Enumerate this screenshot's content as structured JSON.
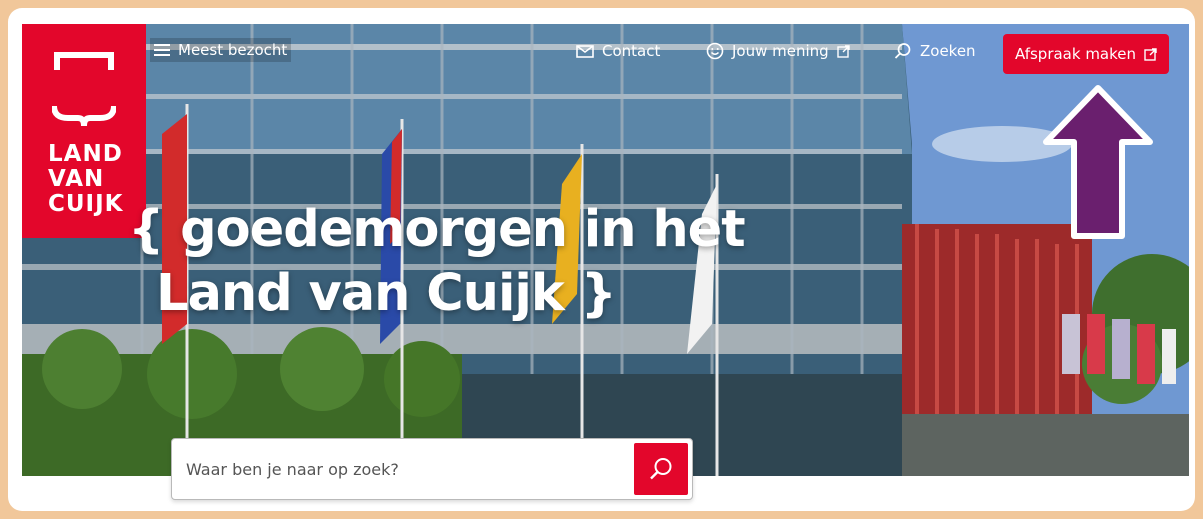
{
  "logo": {
    "line1": "LAND",
    "line2": "VAN",
    "line3": "CUIJK"
  },
  "nav": {
    "menu_label": "Meest bezocht",
    "contact_label": "Contact",
    "opinion_label": "Jouw mening",
    "search_label": "Zoeken",
    "cta_label": "Afspraak maken"
  },
  "hero": {
    "headline_line1": "{ goedemorgen in het",
    "headline_line2": "Land van Cuijk }"
  },
  "search": {
    "placeholder": "Waar ben je naar op zoek?"
  },
  "colors": {
    "brand_red": "#e3062b",
    "annotation_arrow": "#6a1f6e",
    "frame": "#f1c79a"
  },
  "icons": [
    "menu-icon",
    "mail-icon",
    "smiley-icon",
    "external-link-icon",
    "search-icon"
  ]
}
